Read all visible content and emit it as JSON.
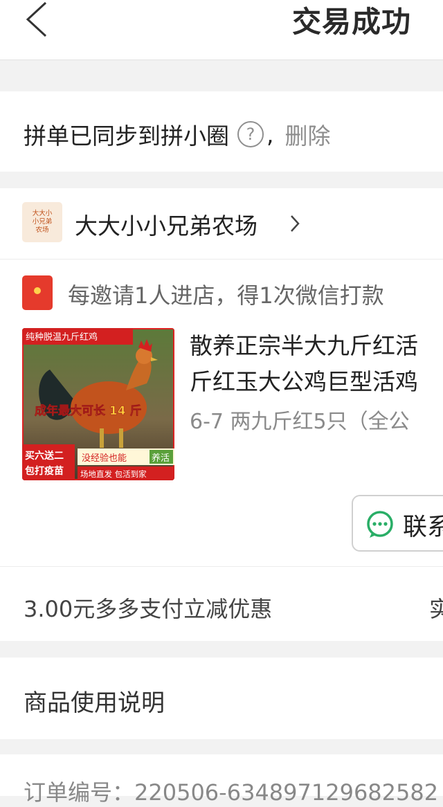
{
  "header": {
    "title": "交易成功"
  },
  "sync": {
    "text": "拼单已同步到拼小圈",
    "help": "?",
    "comma": ",",
    "delete_label": "删除"
  },
  "store": {
    "name": "大大小小兄弟农场",
    "logo_text": "大大小\n小兄弟\n农场"
  },
  "promo": {
    "text": "每邀请1人进店，得1次微信打款"
  },
  "product": {
    "title_line1": "散养正宗半大九斤红活",
    "title_line2": "斤红玉大公鸡巨型活鸡",
    "spec": "6-7 两九斤红5只（全公",
    "image_text": {
      "top": "纯种脱温九斤红鸡",
      "middle": "成年最大可长 14 斤",
      "badge_left1": "买六送二",
      "badge_left2": "包打疫苗",
      "badge_right1a": "没经验也能",
      "badge_right1b": "养活",
      "badge_right2": "场地直发  包活到家"
    }
  },
  "contact": {
    "label": "联系"
  },
  "discount": {
    "text": "3.00元多多支付立减优惠",
    "right": "实"
  },
  "instructions": {
    "label": "商品使用说明"
  },
  "order": {
    "number_text": "订单编号：220506-634897129682582"
  },
  "icons": {
    "back": "back-arrow-icon",
    "help": "question-circle-icon",
    "chevron": "chevron-right-icon",
    "redpacket": "red-packet-icon",
    "chat": "wechat-chat-icon"
  },
  "colors": {
    "accent_green": "#2aae67",
    "red": "#e02e24",
    "gray_text": "#8e8e8e"
  }
}
